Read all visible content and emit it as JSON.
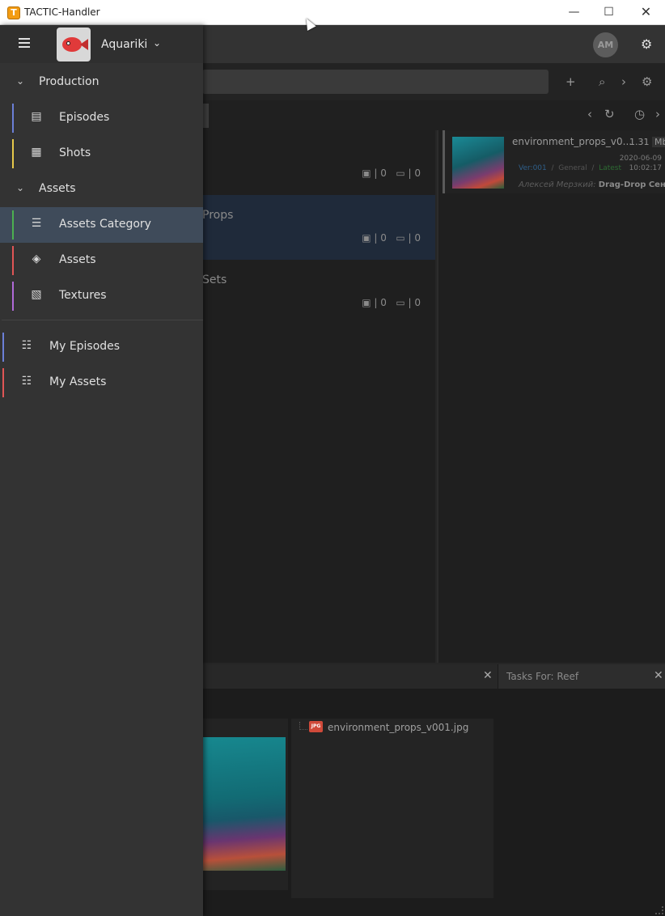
{
  "window": {
    "app_icon": "T",
    "title": "TACTIC-Handler",
    "min_glyph": "—",
    "max_glyph": "☐",
    "close_glyph": "✕"
  },
  "header": {
    "project_name": "Aquariki",
    "avatar_initials": "AM"
  },
  "drawer": {
    "sections": [
      {
        "label": "Production",
        "items": [
          {
            "label": "Episodes",
            "color": "#6b7fd7",
            "icon": "episodes-icon"
          },
          {
            "label": "Shots",
            "color": "#e6c84a",
            "icon": "film-icon"
          }
        ]
      },
      {
        "label": "Assets",
        "items": [
          {
            "label": "Assets Category",
            "color": "#4caf50",
            "icon": "grid-list-icon",
            "active": true
          },
          {
            "label": "Assets",
            "color": "#e05555",
            "icon": "cube-icon"
          },
          {
            "label": "Textures",
            "color": "#b06ad8",
            "icon": "image-stack-icon"
          }
        ]
      }
    ],
    "top_items": [
      {
        "label": "My Episodes",
        "color": "#6b7fd7",
        "icon": "checklist-icon"
      },
      {
        "label": "My Assets",
        "color": "#e05555",
        "icon": "checklist-icon"
      }
    ]
  },
  "categories": [
    {
      "name": "",
      "tasks_count": "| 0",
      "notes_count": "| 0"
    },
    {
      "name": "Props",
      "tasks_count": "| 0",
      "notes_count": "| 0"
    },
    {
      "name": "Sets",
      "tasks_count": "| 0",
      "notes_count": "| 0"
    }
  ],
  "file": {
    "name": "environment_props_v0...",
    "size": "1.31",
    "size_unit": "Mb",
    "date": "2020-06-09",
    "time": "10:02:17",
    "version": "Ver:001",
    "context": "General",
    "status": "Latest",
    "author": "Алексей Мерзкий:",
    "description": "Drag-Drop Сен..."
  },
  "bottom": {
    "tasks_tab_label": "Tasks For: Reef",
    "file_tree_item": "environment_props_v001.jpg",
    "jpg_label": "JPG"
  }
}
